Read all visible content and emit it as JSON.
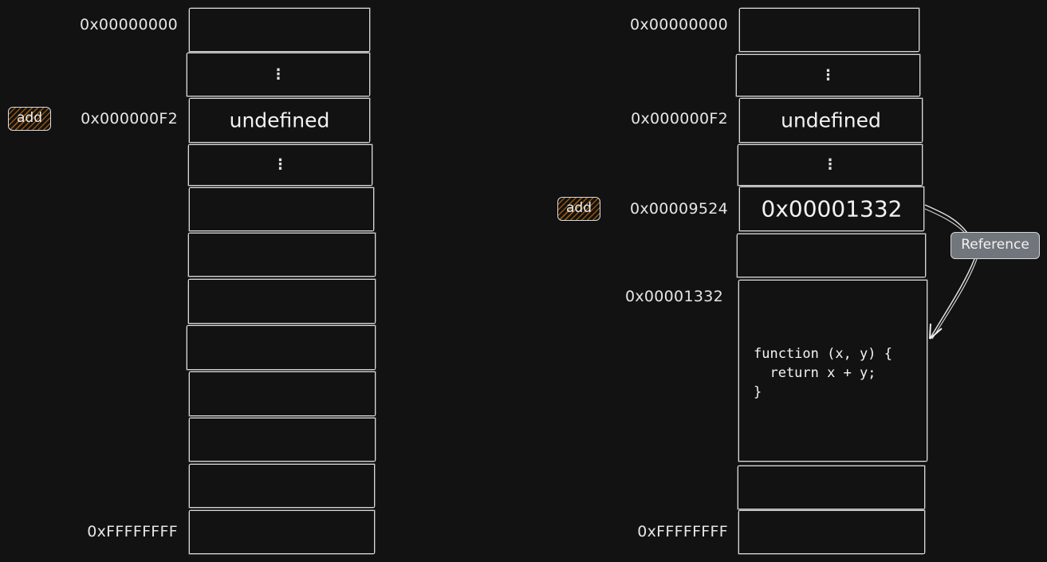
{
  "colors": {
    "background": "#121212",
    "stroke": "#d8d8d8",
    "highlight_brown": "#9c5a10",
    "highlight_blue": "#2678c8",
    "highlight_gray": "#787d84",
    "reference_badge": "#71757c"
  },
  "left_panel": {
    "variable_label": "add",
    "addresses": {
      "start": "0x00000000",
      "add_slot": "0x000000F2",
      "end": "0xFFFFFFFF"
    },
    "cells": [
      {
        "content": ""
      },
      {
        "content": "⋮"
      },
      {
        "content": "undefined",
        "highlight": "brown"
      },
      {
        "content": "⋮"
      },
      {
        "content": ""
      },
      {
        "content": ""
      },
      {
        "content": ""
      },
      {
        "content": ""
      },
      {
        "content": ""
      },
      {
        "content": ""
      },
      {
        "content": ""
      },
      {
        "content": ""
      }
    ]
  },
  "right_panel": {
    "variable_label": "add",
    "addresses": {
      "start": "0x00000000",
      "old_slot": "0x000000F2",
      "add_slot": "0x00009524",
      "function_slot": "0x00001332",
      "end": "0xFFFFFFFF"
    },
    "cells": [
      {
        "content": ""
      },
      {
        "content": "⋮"
      },
      {
        "content": "undefined",
        "highlight": "gray"
      },
      {
        "content": "⋮"
      },
      {
        "content": "0x00001332",
        "highlight": "blue"
      },
      {
        "content": ""
      },
      {
        "content": "function (x, y) {\n  return x + y;\n}",
        "highlight": "blue"
      },
      {
        "content": ""
      },
      {
        "content": ""
      }
    ],
    "reference_label": "Reference"
  }
}
